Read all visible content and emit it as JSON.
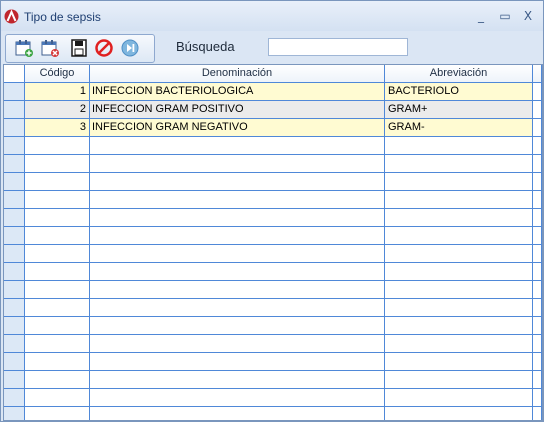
{
  "window": {
    "title": "Tipo de sepsis",
    "minimize_glyph": "_",
    "maximize_glyph": "▭",
    "close_glyph": "X"
  },
  "toolbar": {
    "buttons": [
      {
        "name": "new-record",
        "icon": "calendar-add-icon"
      },
      {
        "name": "delete-record",
        "icon": "calendar-delete-icon"
      },
      {
        "name": "save",
        "icon": "save-icon"
      },
      {
        "name": "cancel",
        "icon": "cancel-icon"
      },
      {
        "name": "exit",
        "icon": "exit-icon"
      }
    ]
  },
  "search": {
    "label": "Búsqueda",
    "value": ""
  },
  "table": {
    "columns": [
      "Código",
      "Denominación",
      "Abreviación"
    ],
    "rows": [
      {
        "codigo": "1",
        "denominacion": "INFECCION BACTERIOLOGICA",
        "abreviacion": "BACTERIOLO"
      },
      {
        "codigo": "2",
        "denominacion": "INFECCION GRAM POSITIVO",
        "abreviacion": "GRAM+"
      },
      {
        "codigo": "3",
        "denominacion": "INFECCION GRAM NEGATIVO",
        "abreviacion": "GRAM-"
      }
    ]
  },
  "colors": {
    "row_highlight": "#fffbd2",
    "row_alt": "#ebebeb",
    "grid_lines": "#4f88d8",
    "window_bg": "#dbe6f4"
  }
}
